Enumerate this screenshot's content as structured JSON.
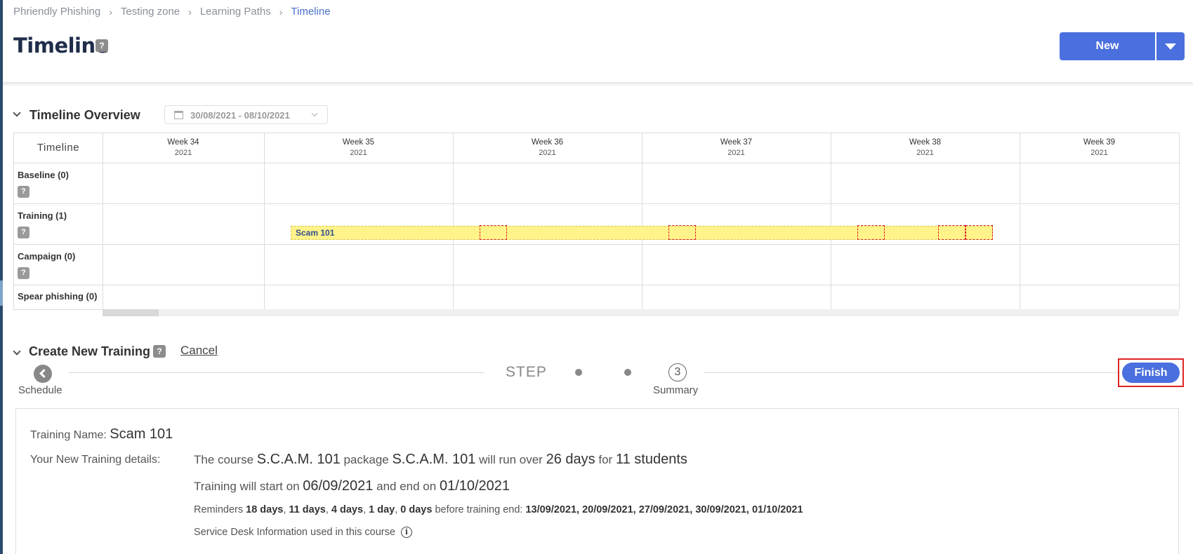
{
  "breadcrumb": [
    "Phriendly Phishing",
    "Testing zone",
    "Learning Paths",
    "Timeline"
  ],
  "page": {
    "title": "Timeline",
    "help": "?"
  },
  "actions": {
    "new_label": "New"
  },
  "overview": {
    "title": "Timeline Overview",
    "date_range": "30/08/2021 - 08/10/2021",
    "corner_label": "Timeline",
    "weeks": [
      {
        "week": "Week 34",
        "year": "2021"
      },
      {
        "week": "Week 35",
        "year": "2021"
      },
      {
        "week": "Week 36",
        "year": "2021"
      },
      {
        "week": "Week 37",
        "year": "2021"
      },
      {
        "week": "Week 38",
        "year": "2021"
      },
      {
        "week": "Week 39",
        "year": "2021"
      }
    ],
    "rows": [
      {
        "label": "Baseline (0)",
        "help": "?"
      },
      {
        "label": "Training (1)",
        "help": "?"
      },
      {
        "label": "Campaign (0)",
        "help": "?"
      },
      {
        "label": "Spear phishing (0)"
      }
    ],
    "training_item": "Scam 101"
  },
  "create": {
    "title": "Create New Training",
    "help": "?",
    "cancel": "Cancel",
    "back_label": "Schedule",
    "step_word": "STEP",
    "current_step": "3",
    "current_step_label": "Summary",
    "finish": "Finish"
  },
  "summary": {
    "name_label": "Training Name:",
    "name_value": "Scam 101",
    "details_label": "Your New Training details:",
    "course_pre": "The course",
    "course": "S.C.A.M. 101",
    "package_pre": "package",
    "package": "S.C.A.M. 101",
    "run_pre": "will run over",
    "days": "26 days",
    "for": "for",
    "students": "11 students",
    "start_pre": "Training will start on",
    "start": "06/09/2021",
    "end_pre": "and end on",
    "end": "01/10/2021",
    "reminders_pre": "Reminders",
    "reminders": [
      "18 days",
      "11 days",
      "4 days",
      "1 day",
      "0 days"
    ],
    "reminders_post": "before training end:",
    "reminder_dates": "13/09/2021, 20/09/2021, 27/09/2021, 30/09/2021, 01/10/2021",
    "service_desk": "Service Desk Information used in this course"
  },
  "colors": {
    "accent": "#4a6fde",
    "training_bar": "#fff389",
    "highlight": "#e02424"
  }
}
